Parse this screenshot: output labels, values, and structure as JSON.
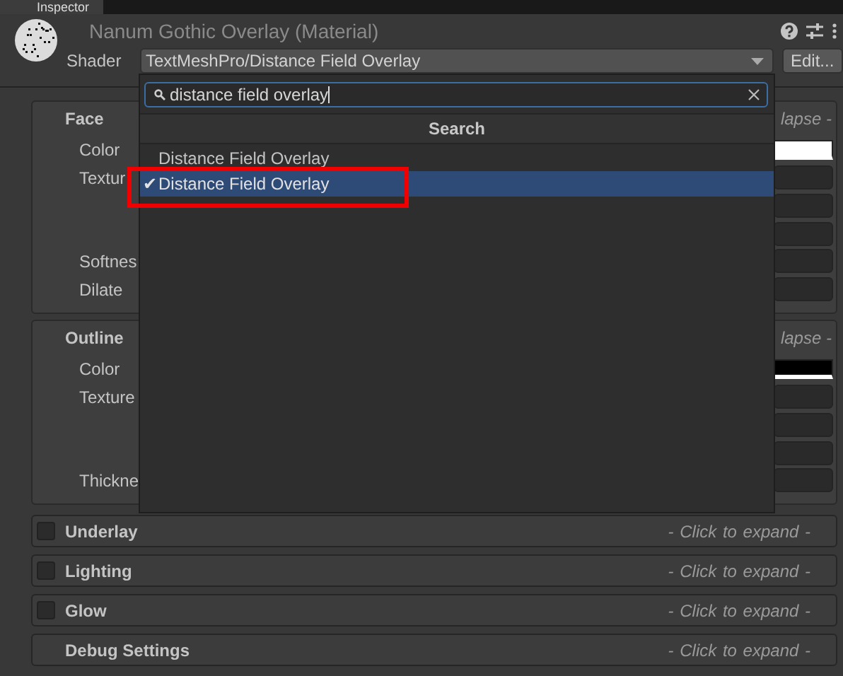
{
  "tab": {
    "label": "Inspector",
    "selected": true
  },
  "material": {
    "title": "Nanum Gothic Overlay (Material)",
    "shader_label": "Shader",
    "shader_value": "TextMeshPro/Distance Field Overlay",
    "edit_button": "Edit..."
  },
  "sections": [
    {
      "title": "Face",
      "toggle_hint": "lapse -",
      "rows": [
        {
          "label": "Color",
          "kind": "color",
          "color": "#ffffff"
        },
        {
          "label": "Textur",
          "kind": "texture"
        },
        {
          "label": "Softnes",
          "kind": "number"
        },
        {
          "label": "Dilate",
          "kind": "number"
        }
      ]
    },
    {
      "title": "Outline",
      "toggle_hint": "lapse -",
      "rows": [
        {
          "label": "Color",
          "kind": "color",
          "color": "#000000"
        },
        {
          "label": "Texture",
          "kind": "texture"
        },
        {
          "label": "Thickne",
          "kind": "number"
        }
      ]
    }
  ],
  "folds": [
    {
      "kind": "toggle",
      "title": "Underlay",
      "checked": false,
      "hint": "- Click to expand -"
    },
    {
      "kind": "toggle",
      "title": "Lighting",
      "checked": false,
      "hint": "- Click to expand -"
    },
    {
      "kind": "toggle",
      "title": "Glow",
      "checked": false,
      "hint": "- Click to expand -"
    },
    {
      "kind": "plain",
      "title": "Debug Settings",
      "hint": "- Click to expand -"
    }
  ],
  "popup": {
    "search": {
      "value": "distance field overlay"
    },
    "header": "Search",
    "check_mark": "✔",
    "items": [
      {
        "label": "Distance Field Overlay",
        "selected": false,
        "highlighted": false
      },
      {
        "label": "Distance Field Overlay",
        "selected": true,
        "highlighted": true
      }
    ]
  }
}
